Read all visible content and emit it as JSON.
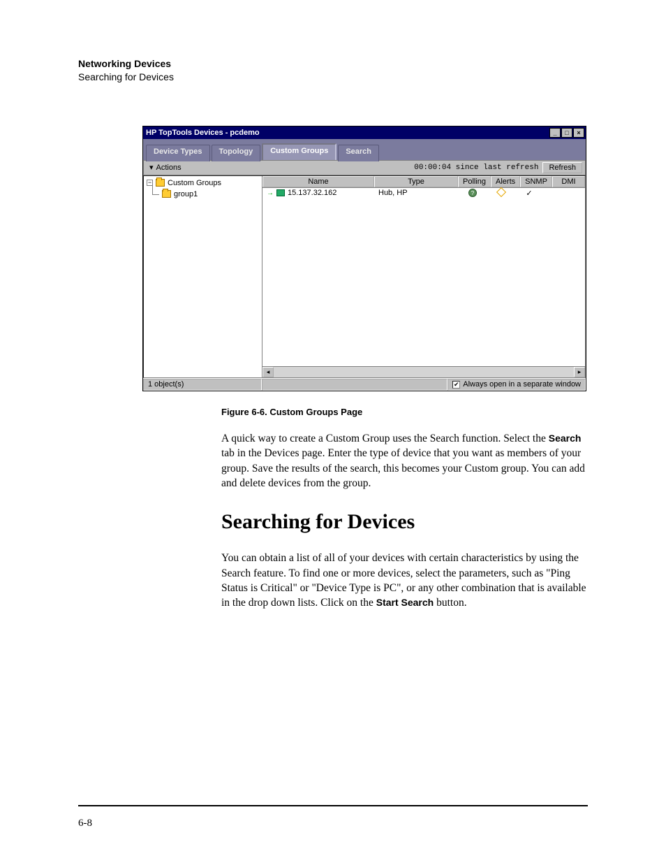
{
  "doc": {
    "header_bold": "Networking Devices",
    "header_sub": "Searching for Devices",
    "caption": "Figure 6-6.    Custom Groups Page",
    "para1_a": "A quick way to create a Custom Group uses the Search function. Select the ",
    "para1_bold": "Search",
    "para1_b": " tab in the Devices page. Enter the type of device that you want as members of your group. Save the results of the search, this becomes your Custom group. You can add and delete devices from the group.",
    "h2": "Searching for Devices",
    "para2_a": "You can obtain a list of all of your devices with certain characteristics by using the Search feature. To find one or more devices, select the parameters, such as \"Ping Status is Critical\" or \"Device Type is PC\", or any other combination that is available in the drop down lists. Click on the ",
    "para2_bold": "Start Search",
    "para2_b": " button.",
    "page_num": "6-8"
  },
  "win": {
    "title": "HP TopTools Devices - pcdemo",
    "tabs": {
      "device_types": "Device Types",
      "topology": "Topology",
      "custom_groups": "Custom Groups",
      "search": "Search"
    },
    "actions_label": "Actions",
    "refresh_text": "00:00:04 since last refresh",
    "refresh_btn": "Refresh",
    "tree": {
      "root": "Custom Groups",
      "child": "group1"
    },
    "cols": {
      "name": "Name",
      "type": "Type",
      "polling": "Polling",
      "alerts": "Alerts",
      "snmp": "SNMP",
      "dmi": "DMI"
    },
    "row": {
      "name": "15.137.32.162",
      "type": "Hub, HP",
      "polling": "?",
      "snmp": "✓"
    },
    "status_objects": "1 object(s)",
    "status_checkbox": "Always open in a separate window",
    "minimize": "_",
    "maximize": "□",
    "close": "×",
    "scroll_left": "◂",
    "scroll_right": "▸",
    "checkmark": "✔",
    "triangle_down": "▾",
    "expander": "−"
  }
}
